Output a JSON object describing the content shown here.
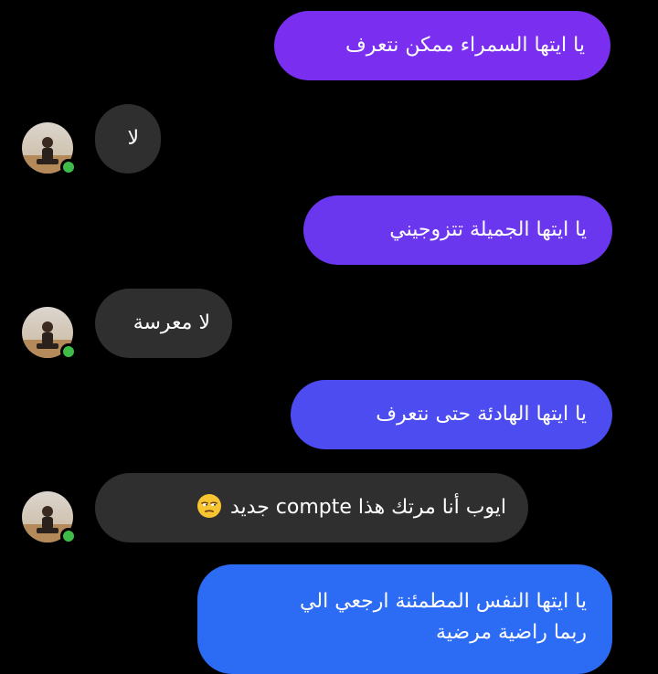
{
  "colors": {
    "background": "#000000",
    "incoming_bubble": "#2f2f2f",
    "online": "#3fbb4a",
    "outgoing_gradient": [
      "#7a2ff0",
      "#6a37ef",
      "#5a43ee",
      "#4a4ff0",
      "#3c5cf2",
      "#2c6cf4"
    ]
  },
  "contact": {
    "avatar_icon": "profile-photo",
    "online_icon": "online-status-dot"
  },
  "messages": [
    {
      "direction": "outgoing",
      "text": "يا ايتها السمراء ممكن نتعرف"
    },
    {
      "direction": "incoming",
      "text": "لا"
    },
    {
      "direction": "outgoing",
      "text": "يا ايتها الجميلة تتزوجيني"
    },
    {
      "direction": "incoming",
      "text": "لا معرسة"
    },
    {
      "direction": "outgoing",
      "text": "يا ايتها الهادئة حتى نتعرف"
    },
    {
      "direction": "incoming",
      "text_before": "ايوب أنا مرتك هذا",
      "text_latin": "compte",
      "text_after": "جديد",
      "emoji": "unamused-face-emoji"
    },
    {
      "direction": "outgoing",
      "lines": [
        "يا ايتها النفس المطمئنة ارجعي الي",
        "ربما راضية مرضية"
      ]
    }
  ]
}
